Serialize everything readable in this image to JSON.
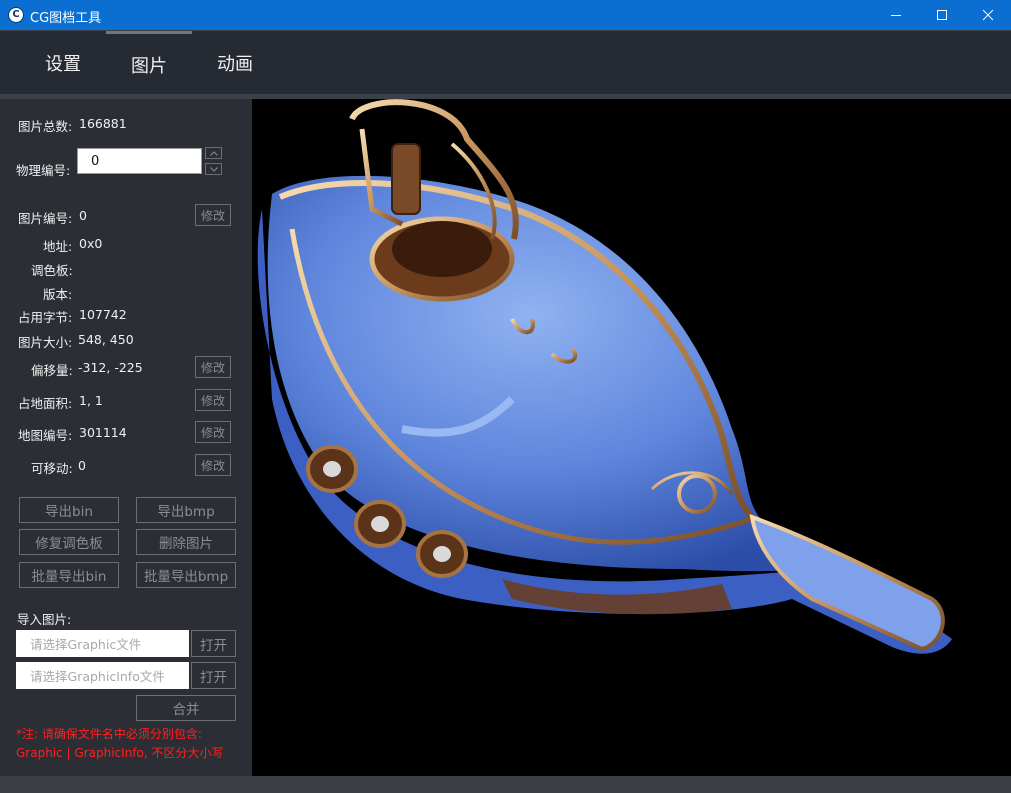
{
  "window": {
    "title": "CG图档工具"
  },
  "tabs": [
    {
      "label": "设置"
    },
    {
      "label": "图片"
    },
    {
      "label": "动画"
    }
  ],
  "panel": {
    "total_label": "图片总数:",
    "total_value": "166881",
    "physical_id_label": "物理编号:",
    "physical_id_value": "0",
    "spin_up": "^",
    "spin_down": "v",
    "image_id_label": "图片编号:",
    "image_id_value": "0",
    "address_label": "地址:",
    "address_value": "0x0",
    "palette_label": "调色板:",
    "version_label": "版本:",
    "bytes_label": "占用字节:",
    "bytes_value": "107742",
    "size_label": "图片大小:",
    "size_value": "548, 450",
    "offset_label": "偏移量:",
    "offset_value": "-312, -225",
    "area_label": "占地面积:",
    "area_value": "1, 1",
    "map_id_label": "地图编号:",
    "map_id_value": "301114",
    "movable_label": "可移动:",
    "movable_value": "0",
    "edit_label": "修改",
    "export_bin": "导出bin",
    "export_bmp": "导出bmp",
    "fix_palette": "修复调色板",
    "delete_image": "删除图片",
    "batch_export_bin": "批量导出bin",
    "batch_export_bmp": "批量导出bmp",
    "import_label": "导入图片:",
    "graphic_placeholder": "请选择Graphic文件",
    "graphicinfo_placeholder": "请选择GraphicInfo文件",
    "open_label": "打开",
    "merge_label": "合并",
    "note_line1": "*注: 请确保文件名中必须分别包含:",
    "note_line2": "Graphic | GraphicInfo, 不区分大小写"
  }
}
